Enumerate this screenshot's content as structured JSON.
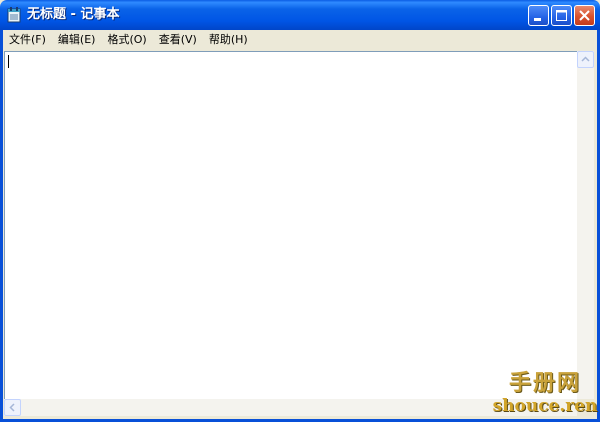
{
  "window": {
    "title": "无标题 - 记事本",
    "app_icon": "notepad-icon",
    "controls": {
      "minimize_icon": "minimize-icon",
      "maximize_icon": "maximize-icon",
      "close_icon": "close-icon"
    },
    "titlebar_color": "#0055e5"
  },
  "menubar": {
    "items": [
      {
        "label": "文件(F)"
      },
      {
        "label": "编辑(E)"
      },
      {
        "label": "格式(O)"
      },
      {
        "label": "查看(V)"
      },
      {
        "label": "帮助(H)"
      }
    ]
  },
  "editor": {
    "content": ""
  },
  "watermark": {
    "line1": "手册网",
    "line2": "shouce.ren"
  }
}
